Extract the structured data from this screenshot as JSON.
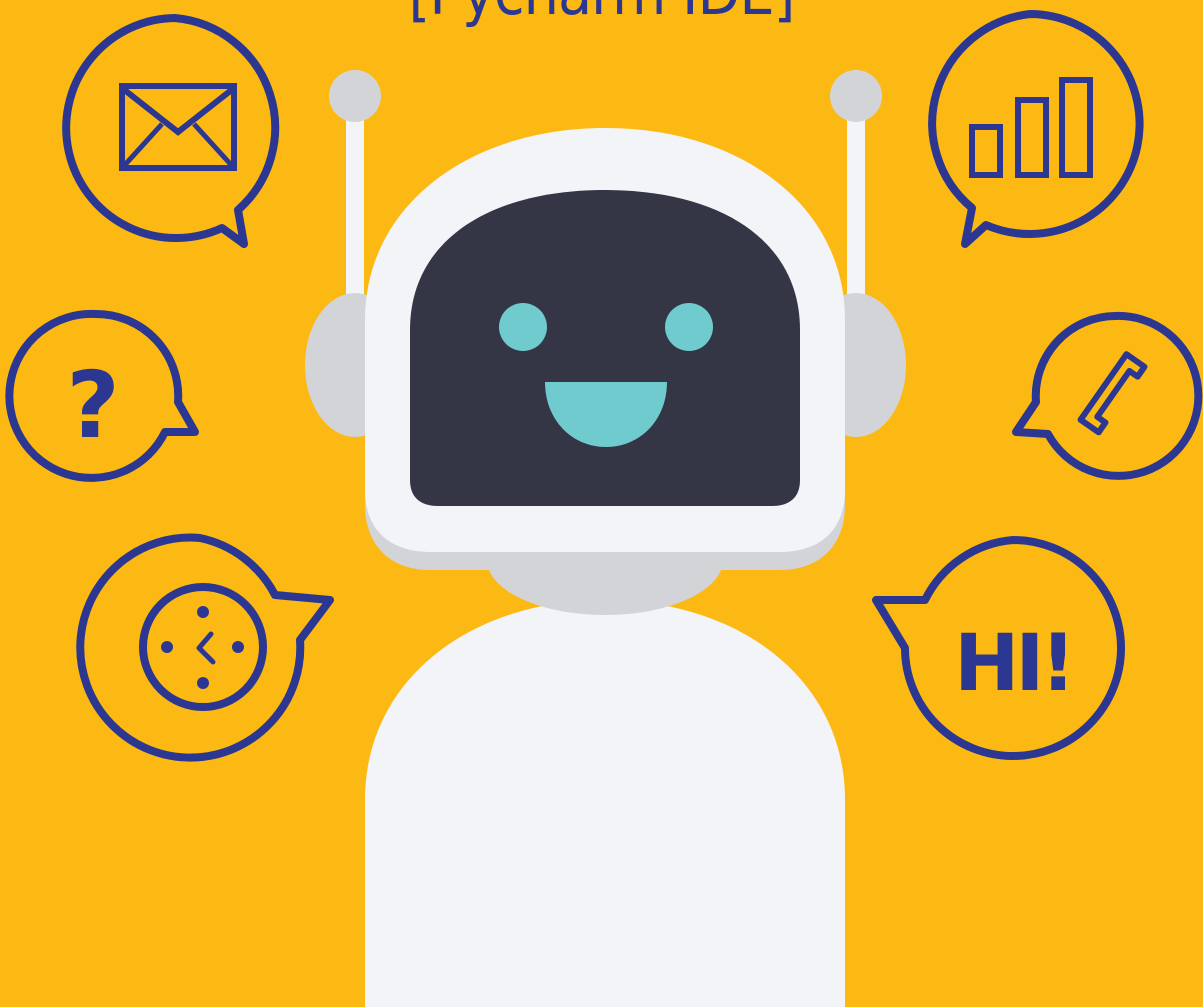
{
  "title": "[Pycharm IDE]",
  "bubbles": {
    "mail": "mail-icon",
    "signal": "bar-chart-icon",
    "question": "?",
    "phone": "phone-icon",
    "clock": "clock-icon",
    "greeting": "HI!"
  },
  "colors": {
    "background": "#FDB913",
    "outline": "#2B3790",
    "robot_body": "#F2F4F7",
    "robot_gray": "#D2D4D8",
    "visor": "#343646",
    "eyes": "#6FCBCD"
  }
}
